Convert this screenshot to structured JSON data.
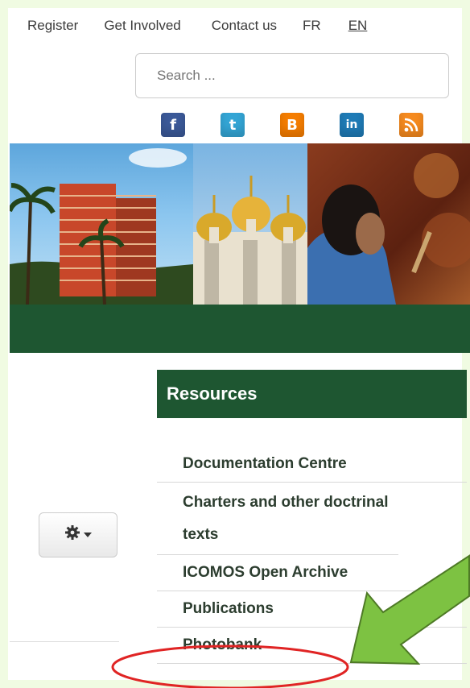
{
  "topnav": {
    "register": "Register",
    "get_involved": "Get Involved",
    "contact_us": "Contact us",
    "fr": "FR",
    "en": "EN"
  },
  "search": {
    "placeholder": "Search ..."
  },
  "social": [
    "facebook-icon",
    "twitter-icon",
    "blogger-icon",
    "linkedin-icon",
    "rss-icon"
  ],
  "sidebar": {
    "title": "Resources",
    "items": [
      {
        "label": "Documentation Centre"
      },
      {
        "label": "Charters and other doctrinal texts"
      },
      {
        "label": "ICOMOS Open Archive"
      },
      {
        "label": "Publications"
      },
      {
        "label": "Photobank"
      }
    ]
  },
  "colors": {
    "brand_green": "#1e5631",
    "annotation_red": "#e02424",
    "annotation_arrow": "#7dc242"
  }
}
